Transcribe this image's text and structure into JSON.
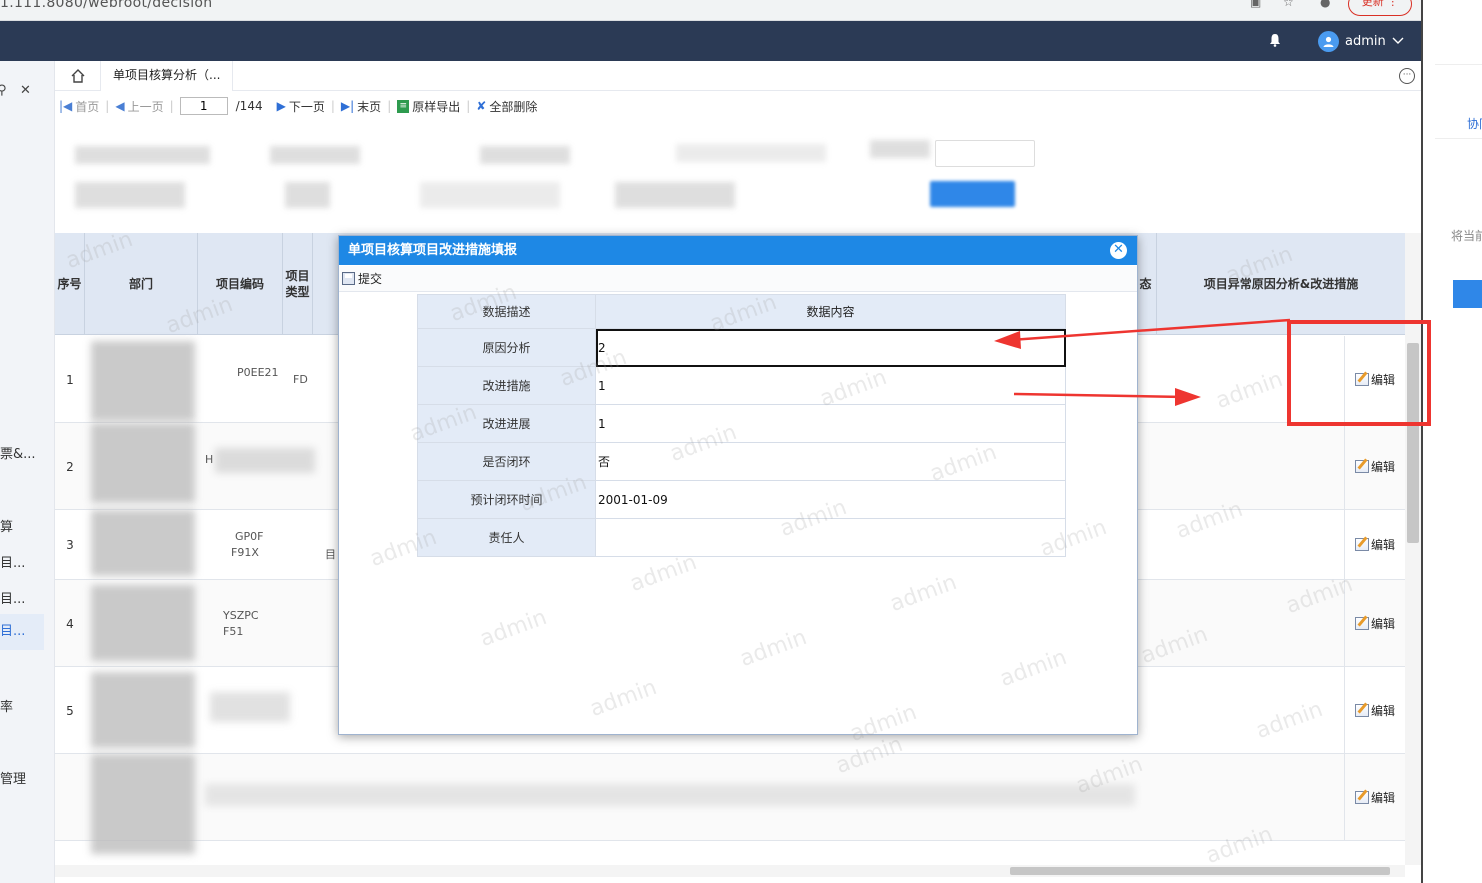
{
  "browser": {
    "url_fragment": "1.111.8080/webroot/decision",
    "update_label": "更新"
  },
  "topnav": {
    "user_name": "admin"
  },
  "sidebar": {
    "items": [
      {
        "label": "票&..."
      },
      {
        "label": "算"
      },
      {
        "label": "目..."
      },
      {
        "label": "目..."
      },
      {
        "label": "目..."
      },
      {
        "label": "率"
      },
      {
        "label": "管理"
      }
    ]
  },
  "tabs": {
    "active_label": "单项目核算分析（..."
  },
  "report_toolbar": {
    "first": "首页",
    "prev": "上一页",
    "current_page": "1",
    "total_pages": "/144",
    "next": "下一页",
    "last": "末页",
    "export": "原样导出",
    "delete_all": "全部删除"
  },
  "grid": {
    "headers": {
      "seq": "序号",
      "dept": "部门",
      "code": "项目编码",
      "type": "项目类型",
      "status_partial": "态",
      "analysis": "项目异常原因分析&改进措施"
    },
    "rows": [
      {
        "num": "1",
        "edit": "编辑"
      },
      {
        "num": "2",
        "edit": "编辑"
      },
      {
        "num": "3",
        "edit": "编辑"
      },
      {
        "num": "4",
        "edit": "编辑"
      },
      {
        "num": "5",
        "edit": "编辑"
      },
      {
        "num": "",
        "edit": "编辑"
      }
    ],
    "partial_texts": {
      "r1_code": "P0EE21",
      "r1_type": "FD",
      "r2_code": "H",
      "r3_code": "GP0F",
      "r3_code2": "F91X",
      "r3_type": "目",
      "r4_code": "YSZPC",
      "r4_code2": "F51"
    }
  },
  "watermark": "admin",
  "modal": {
    "title": "单项目核算项目改进措施填报",
    "submit_label": "提交",
    "col_desc": "数据描述",
    "col_content": "数据内容",
    "fields": [
      {
        "label": "原因分析",
        "value": "2"
      },
      {
        "label": "改进措施",
        "value": "1"
      },
      {
        "label": "改进进展",
        "value": "1"
      },
      {
        "label": "是否闭环",
        "value": "否"
      },
      {
        "label": "预计闭环时间",
        "value": "2001-01-09"
      },
      {
        "label": "责任人",
        "value": ""
      }
    ]
  },
  "right_panel": {
    "text1": "协同",
    "text2": "将当前"
  },
  "colors": {
    "topnav": "#2b3a55",
    "modal_header": "#1e88e5",
    "annotation": "#ee3530",
    "table_header": "#dfe7f3"
  },
  "icons": [
    "home-icon",
    "pin-icon",
    "bell-icon",
    "user-icon",
    "chevron-down-icon",
    "first-page-icon",
    "prev-page-icon",
    "next-page-icon",
    "last-page-icon",
    "export-icon",
    "delete-all-icon",
    "close-icon",
    "save-icon",
    "edit-icon",
    "more-icon"
  ]
}
